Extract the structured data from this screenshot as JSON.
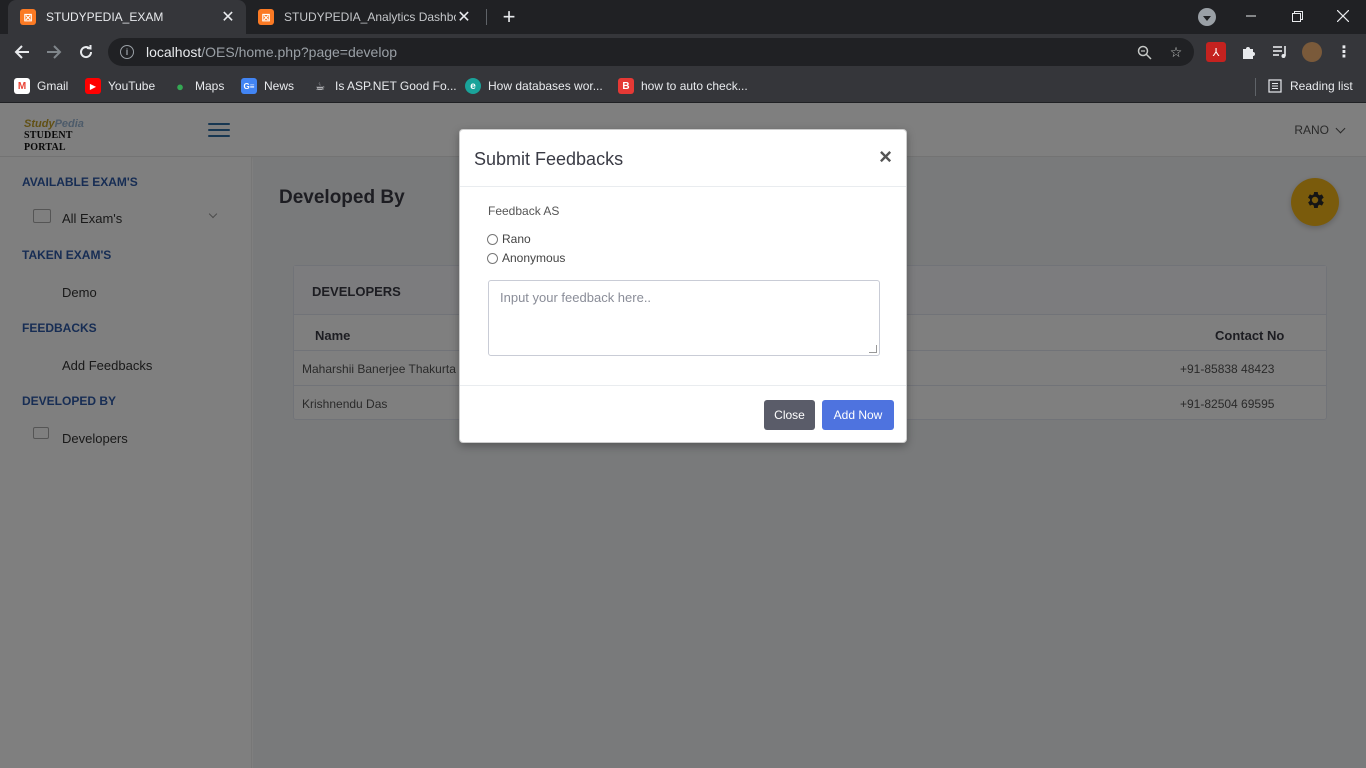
{
  "browser": {
    "tabs": [
      {
        "title": "STUDYPEDIA_EXAM",
        "active": true
      },
      {
        "title": "STUDYPEDIA_Analytics Dashboard",
        "active": false
      }
    ],
    "url_host": "localhost",
    "url_path": "/OES/home.php?page=develop",
    "bookmarks": [
      {
        "label": "Gmail",
        "icon": "gmail-icon"
      },
      {
        "label": "YouTube",
        "icon": "youtube-icon"
      },
      {
        "label": "Maps",
        "icon": "maps-icon"
      },
      {
        "label": "News",
        "icon": "news-icon"
      },
      {
        "label": "Is ASP.NET Good Fo...",
        "icon": "coffee-icon"
      },
      {
        "label": "How databases wor...",
        "icon": "educative-icon"
      },
      {
        "label": "how to auto check...",
        "icon": "b-icon"
      }
    ],
    "reading_list": "Reading list"
  },
  "app": {
    "logo_top_a": "Study",
    "logo_top_b": "Pedia",
    "logo_bottom": "STUDENT PORTAL",
    "user": "RANO",
    "accent": "#4e73df",
    "fab_color": "#f4b619"
  },
  "sidebar": {
    "sections": [
      {
        "heading": "AVAILABLE EXAM'S",
        "item": "All Exam's"
      },
      {
        "heading": "TAKEN EXAM'S",
        "item": "Demo"
      },
      {
        "heading": "FEEDBACKS",
        "item": "Add Feedbacks"
      },
      {
        "heading": "DEVELOPED BY",
        "item": "Developers"
      }
    ]
  },
  "main": {
    "title": "Developed By",
    "card_title": "DEVELOPERS",
    "columns": [
      "Name",
      "Contact No"
    ],
    "rows": [
      [
        "Maharshii Banerjee Thakurta",
        "+91-85838 48423"
      ],
      [
        "Krishnendu Das",
        "+91-82504 69595"
      ]
    ]
  },
  "modal": {
    "title": "Submit Feedbacks",
    "close_glyph": "×",
    "field_label": "Feedback AS",
    "options": [
      "Rano",
      "Anonymous"
    ],
    "placeholder": "Input your feedback here..",
    "close_label": "Close",
    "submit_label": "Add Now"
  }
}
